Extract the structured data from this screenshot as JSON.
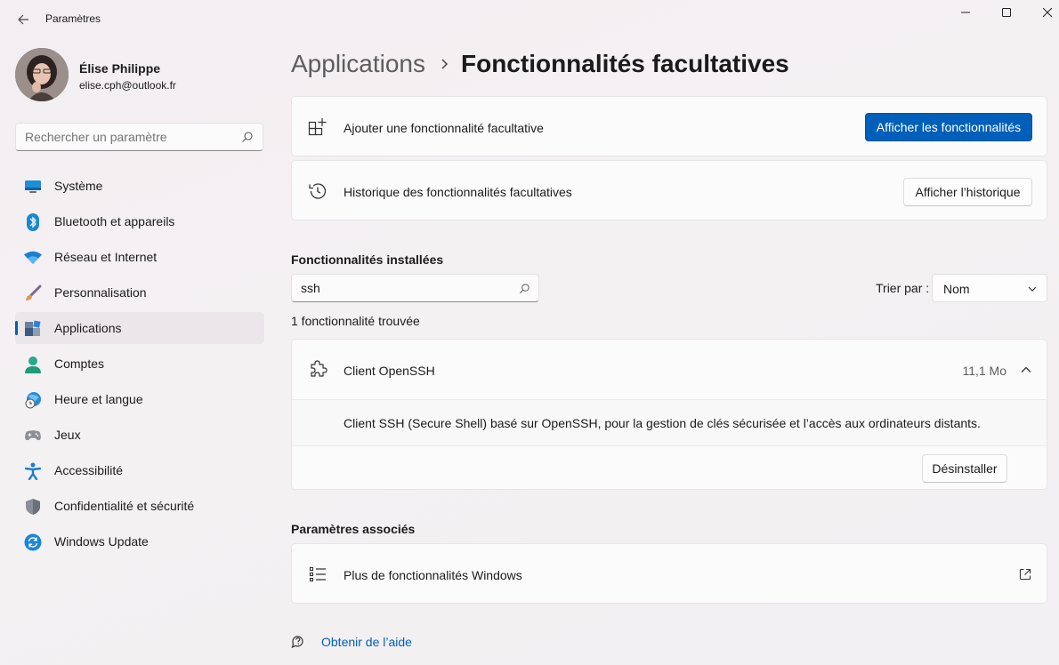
{
  "window": {
    "title": "Paramètres"
  },
  "profile": {
    "name": "Élise Philippe",
    "email": "elise.cph@outlook.fr"
  },
  "search": {
    "placeholder": "Rechercher un paramètre"
  },
  "sidebar": {
    "items": [
      {
        "label": "Système",
        "icon": "system-icon"
      },
      {
        "label": "Bluetooth et appareils",
        "icon": "bluetooth-icon"
      },
      {
        "label": "Réseau et Internet",
        "icon": "wifi-icon"
      },
      {
        "label": "Personnalisation",
        "icon": "brush-icon"
      },
      {
        "label": "Applications",
        "icon": "apps-icon",
        "active": true
      },
      {
        "label": "Comptes",
        "icon": "account-icon"
      },
      {
        "label": "Heure et langue",
        "icon": "globe-clock-icon"
      },
      {
        "label": "Jeux",
        "icon": "gamepad-icon"
      },
      {
        "label": "Accessibilité",
        "icon": "accessibility-icon"
      },
      {
        "label": "Confidentialité et sécurité",
        "icon": "shield-icon"
      },
      {
        "label": "Windows Update",
        "icon": "update-icon"
      }
    ]
  },
  "breadcrumb": {
    "parent": "Applications",
    "current": "Fonctionnalités facultatives"
  },
  "add_feature": {
    "label": "Ajouter une fonctionnalité facultative",
    "button": "Afficher les fonctionnalités"
  },
  "history": {
    "label": "Historique des fonctionnalités facultatives",
    "button": "Afficher l’historique"
  },
  "installed": {
    "title": "Fonctionnalités installées",
    "filter_value": "ssh",
    "sort_label": "Trier par :",
    "sort_value": "Nom",
    "result_count": "1 fonctionnalité trouvée",
    "items": [
      {
        "name": "Client OpenSSH",
        "size": "11,1 Mo",
        "description": "Client SSH (Secure Shell) basé sur OpenSSH, pour la gestion de clés sécurisée et l’accès aux ordinateurs distants.",
        "uninstall_label": "Désinstaller",
        "expanded": true
      }
    ]
  },
  "related": {
    "title": "Paramètres associés",
    "items": [
      {
        "label": "Plus de fonctionnalités Windows"
      }
    ]
  },
  "help": {
    "label": "Obtenir de l’aide"
  },
  "colors": {
    "accent": "#005fb8"
  }
}
